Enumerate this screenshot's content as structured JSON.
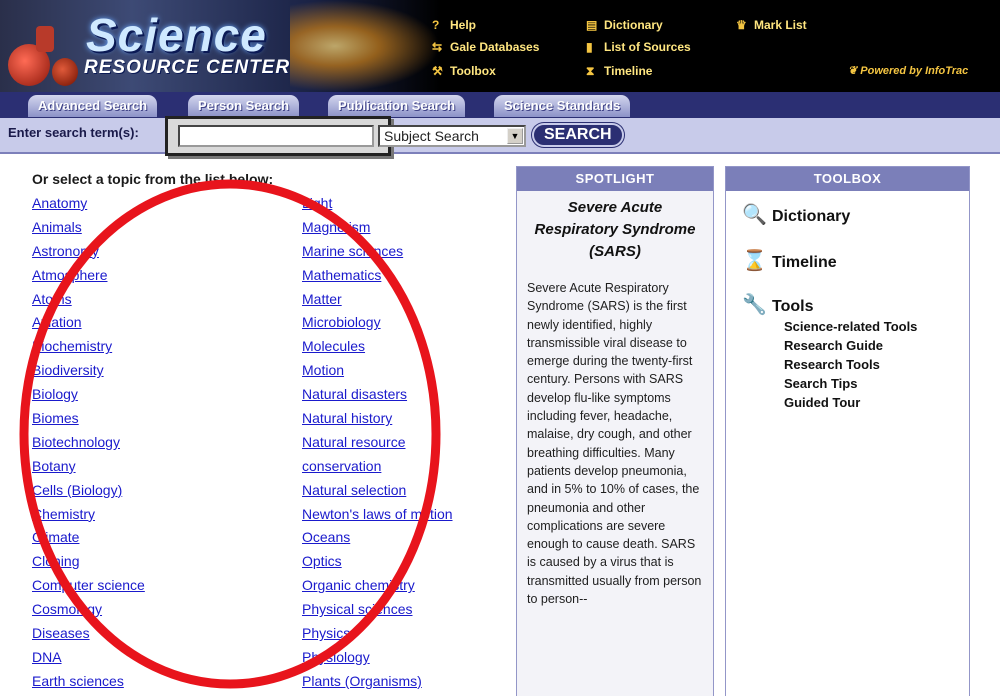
{
  "header": {
    "brand_title": "Science",
    "brand_subtitle": "RESOURCE CENTER",
    "powered_by": "Powered by InfoTrac",
    "top_links": {
      "help": "Help",
      "gale_databases": "Gale Databases",
      "toolbox": "Toolbox",
      "dictionary": "Dictionary",
      "list_of_sources": "List of Sources",
      "timeline": "Timeline",
      "mark_list": "Mark List"
    }
  },
  "tabs": {
    "advanced_search": "Advanced Search",
    "person_search": "Person Search",
    "publication_search": "Publication Search",
    "science_standards": "Science Standards"
  },
  "search": {
    "label": "Enter search term(s):",
    "value": "",
    "type_selected": "Subject Search",
    "button": "SEARCH"
  },
  "topics": {
    "heading": "Or select a topic from the list below:",
    "left": [
      "Anatomy",
      "Animals",
      "Astronomy",
      "Atmosphere",
      "Atoms",
      "Aviation",
      "Biochemistry",
      "Biodiversity",
      "Biology",
      "Biomes",
      "Biotechnology",
      "Botany",
      "Cells (Biology)",
      "Chemistry",
      "Climate",
      "Cloning",
      "Computer science",
      "Cosmology",
      "Diseases",
      "DNA",
      "Earth sciences"
    ],
    "right": [
      "Light",
      "Magnetism",
      "Marine sciences",
      "Mathematics",
      "Matter",
      "Microbiology",
      "Molecules",
      "Motion",
      "Natural disasters",
      "Natural history",
      "Natural resource",
      "conservation",
      "Natural selection",
      "Newton's laws of motion",
      "Oceans",
      "Optics",
      "Organic chemistry",
      "Physical sciences",
      "Physics",
      "Physiology",
      "Plants (Organisms)"
    ]
  },
  "spotlight": {
    "header": "SPOTLIGHT",
    "title": "Severe Acute Respiratory Syndrome (SARS)",
    "body": "Severe Acute Respiratory Syndrome (SARS) is the first newly identified, highly transmissible viral disease to emerge during the twenty-first century. Persons with SARS develop flu-like symptoms including fever, headache, malaise, dry cough, and other breathing difficulties. Many patients develop pneumonia, and in 5% to 10% of cases, the pneumonia and other complications are severe enough to cause death. SARS is caused by a virus that is transmitted usually from person to person--"
  },
  "toolbox": {
    "header": "TOOLBOX",
    "dictionary": "Dictionary",
    "timeline": "Timeline",
    "tools": "Tools",
    "sub_tools": [
      "Science-related Tools",
      "Research Guide",
      "Research Tools",
      "Search Tips",
      "Guided Tour"
    ]
  },
  "annotation": {
    "shape": "ellipse",
    "color": "#e8141c"
  }
}
